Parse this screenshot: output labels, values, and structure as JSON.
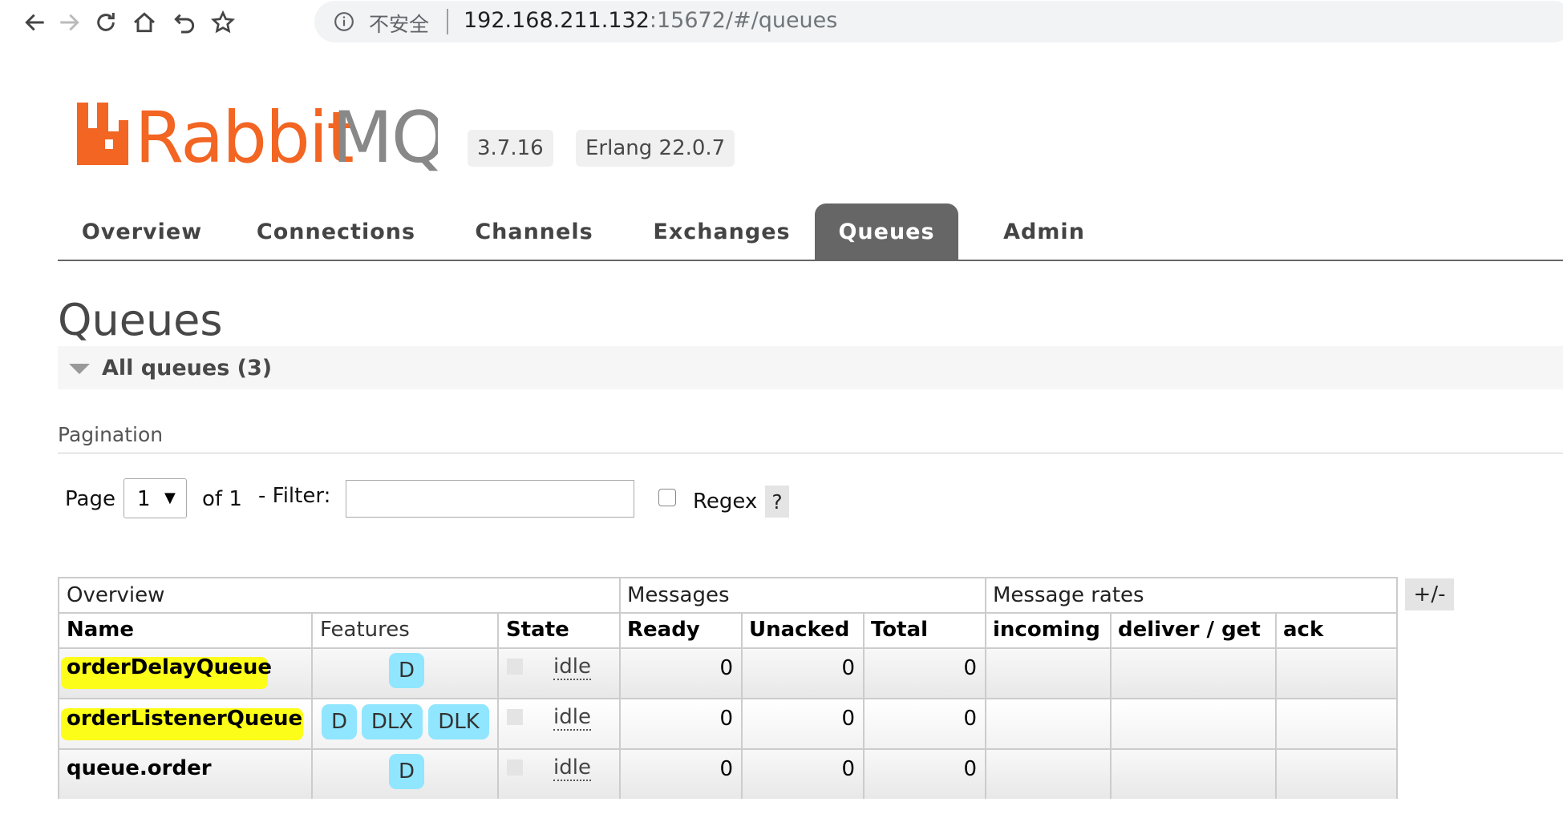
{
  "browser": {
    "security_label": "不安全",
    "url_host": "192.168.211.132",
    "url_rest": ":15672/#/queues"
  },
  "header": {
    "brand": "RabbitMQ",
    "version": "3.7.16",
    "erlang": "Erlang 22.0.7",
    "brand_color": "#f26522"
  },
  "tabs": [
    {
      "label": "Overview",
      "active": false
    },
    {
      "label": "Connections",
      "active": false
    },
    {
      "label": "Channels",
      "active": false
    },
    {
      "label": "Exchanges",
      "active": false
    },
    {
      "label": "Queues",
      "active": true
    },
    {
      "label": "Admin",
      "active": false
    }
  ],
  "page": {
    "title": "Queues",
    "section": "All queues (3)",
    "pagination_label": "Pagination",
    "page_label": "Page",
    "page_value": "1",
    "of_label": "of 1",
    "filter_label": "- Filter:",
    "filter_value": "",
    "regex_label": "Regex",
    "help_label": "?",
    "plusminus_label": "+/-"
  },
  "table": {
    "groups": [
      "Overview",
      "Messages",
      "Message rates"
    ],
    "columns": [
      "Name",
      "Features",
      "State",
      "Ready",
      "Unacked",
      "Total",
      "incoming",
      "deliver / get",
      "ack"
    ],
    "rows": [
      {
        "name": "orderDelayQueue",
        "features": [
          "D"
        ],
        "state": "idle",
        "ready": "0",
        "unacked": "0",
        "total": "0"
      },
      {
        "name": "orderListenerQueue",
        "features": [
          "D",
          "DLX",
          "DLK"
        ],
        "state": "idle",
        "ready": "0",
        "unacked": "0",
        "total": "0"
      },
      {
        "name": "queue.order",
        "features": [
          "D"
        ],
        "state": "idle",
        "ready": "0",
        "unacked": "0",
        "total": "0"
      }
    ]
  }
}
